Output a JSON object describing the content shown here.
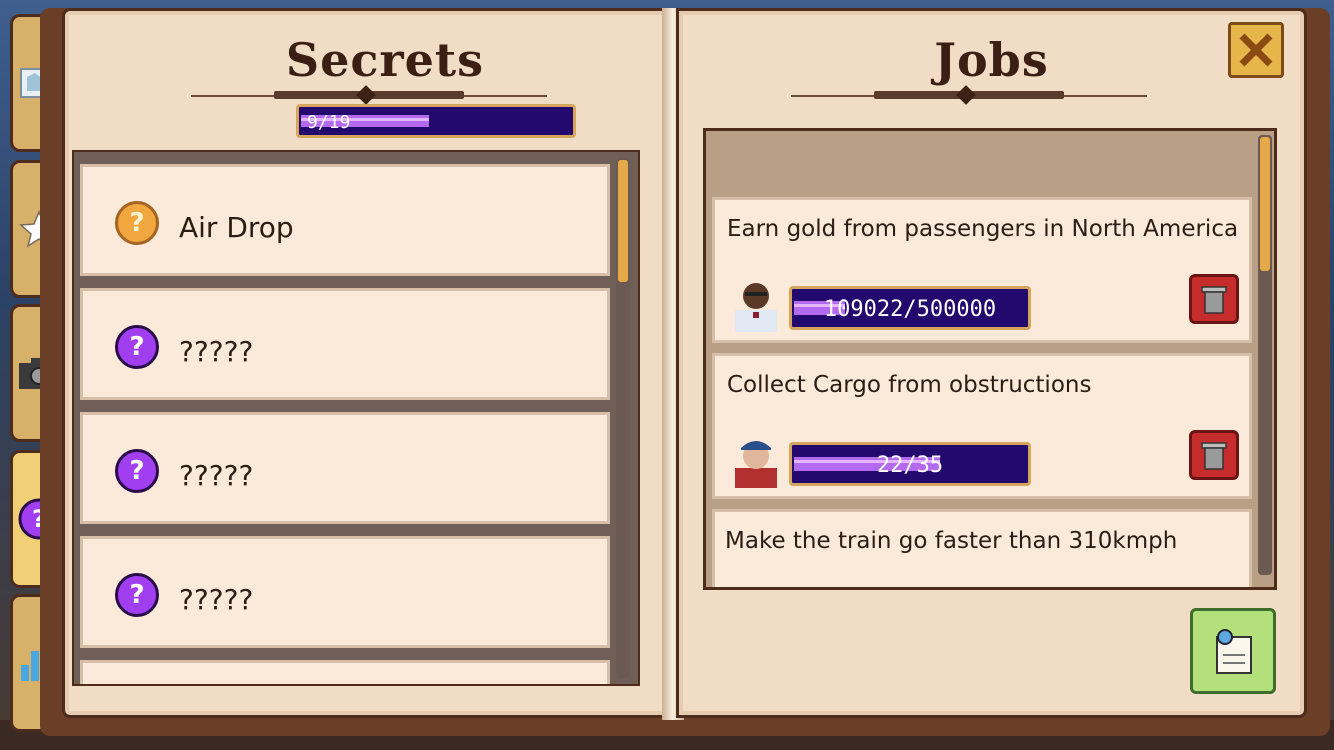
{
  "tabs": [
    {
      "name": "map",
      "icon": "map-icon"
    },
    {
      "name": "favorites",
      "icon": "star-icon"
    },
    {
      "name": "photos",
      "icon": "camera-icon"
    },
    {
      "name": "secrets",
      "icon": "question-icon",
      "active": true
    },
    {
      "name": "stats",
      "icon": "bar-chart-icon"
    }
  ],
  "secrets": {
    "title": "Secrets",
    "progress": {
      "label": "9/19",
      "value": 9,
      "max": 19
    },
    "items": [
      {
        "label": "Air Drop",
        "icon": "question-gold-icon"
      },
      {
        "label": "?????",
        "icon": "question-purple-icon"
      },
      {
        "label": "?????",
        "icon": "question-purple-icon"
      },
      {
        "label": "?????",
        "icon": "question-purple-icon"
      }
    ]
  },
  "jobs": {
    "title": "Jobs",
    "items": [
      {
        "title": "Earn gold from passengers in North America",
        "progress_label": "109022/500000",
        "value": 109022,
        "max": 500000,
        "avatar": "businessman-avatar"
      },
      {
        "title": "Collect Cargo from obstructions",
        "progress_label": "22/35",
        "value": 22,
        "max": 35,
        "avatar": "worker-cap-avatar"
      },
      {
        "title": "Make the train go faster than 310kmph"
      }
    ]
  },
  "buttons": {
    "close": "close-x-icon",
    "journal": "notepad-icon"
  }
}
